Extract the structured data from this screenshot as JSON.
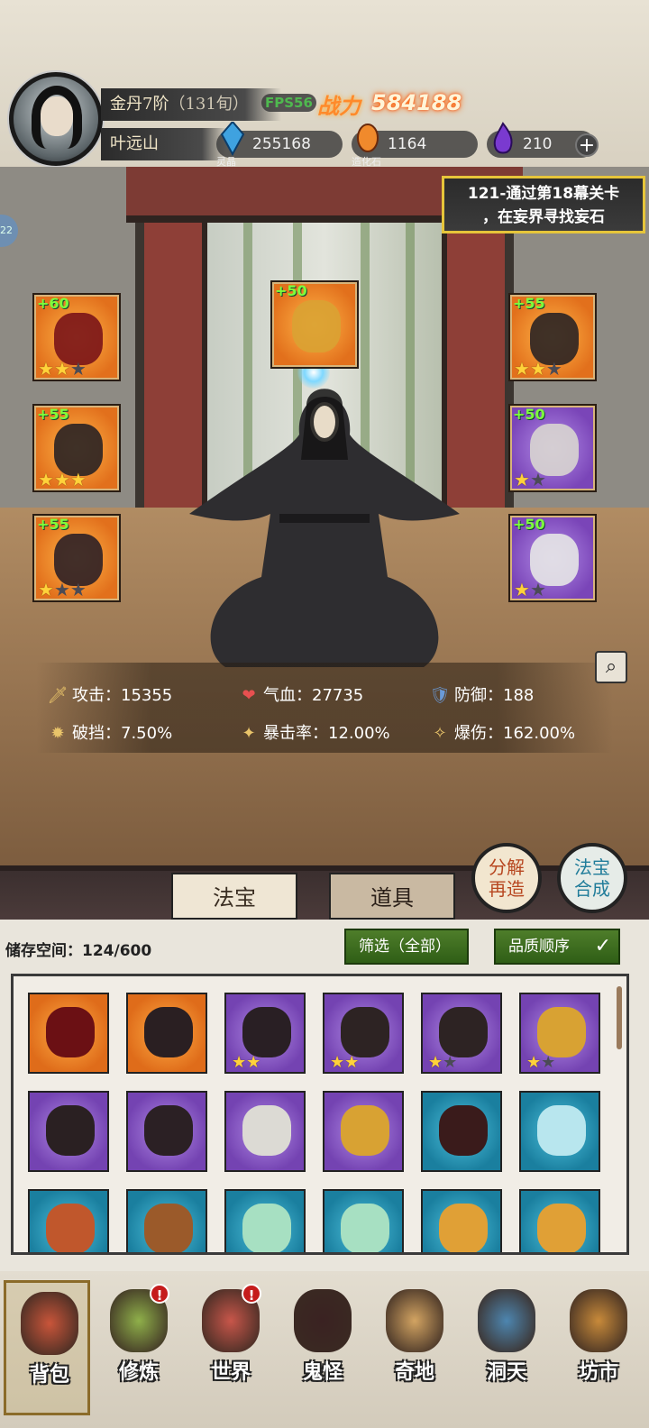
{
  "player": {
    "rank": "金丹7阶",
    "rank_detail": "（131旬）",
    "name": "叶远山",
    "fps": "FPS56",
    "power_label": "战力",
    "power": "584188"
  },
  "resources": [
    {
      "label": "灵晶",
      "value": "255168",
      "icon": "blue-crystal-icon",
      "color": "#3fa2e0"
    },
    {
      "label": "造化石",
      "value": "1164",
      "icon": "orange-stone-icon",
      "color": "#f08a2c"
    },
    {
      "label": "",
      "value": "210",
      "icon": "purple-flame-icon",
      "color": "#7a3ad0"
    }
  ],
  "quest": {
    "line1": "121-通过第18幕关卡",
    "line2": "，在妄界寻找妄石"
  },
  "side_tab": "22",
  "equipment": [
    {
      "level": "+60",
      "stars": 2,
      "max": 3,
      "color": "orange",
      "art": "#7a1418"
    },
    {
      "level": "+50",
      "stars": 0,
      "max": 0,
      "color": "orange",
      "art": "#d9a233"
    },
    {
      "level": "+55",
      "stars": 2,
      "max": 3,
      "color": "orange",
      "art": "#2b2323"
    },
    {
      "level": "+55",
      "stars": 3,
      "max": 3,
      "color": "orange",
      "art": "#2a2224"
    },
    {
      "level": "+50",
      "stars": 1,
      "max": 2,
      "color": "purple",
      "art": "#d8d5d0"
    },
    {
      "level": "+55",
      "stars": 1,
      "max": 3,
      "color": "orange",
      "art": "#2d2026"
    },
    {
      "level": "+50",
      "stars": 1,
      "max": 2,
      "color": "purple",
      "art": "#e6e6e6"
    }
  ],
  "stats": [
    {
      "icon": "sword-icon",
      "glyph": "🗡",
      "text": "攻击：15355"
    },
    {
      "icon": "heart-icon",
      "glyph": "❤",
      "text": "气血：27735"
    },
    {
      "icon": "shield-icon",
      "glyph": "🛡",
      "text": "防御：188"
    },
    {
      "icon": "break-icon",
      "glyph": "✹",
      "text": "破挡：7.50%"
    },
    {
      "icon": "crit-rate-icon",
      "glyph": "✦",
      "text": "暴击率：12.00%"
    },
    {
      "icon": "crit-damage-icon",
      "glyph": "✧",
      "text": "爆伤：162.00%"
    }
  ],
  "tabs": [
    "法宝",
    "道具"
  ],
  "round_buttons": {
    "decompose": [
      "分解",
      "再造"
    ],
    "synthesize": [
      "法宝",
      "合成"
    ]
  },
  "inventory": {
    "storage_label": "储存空间：124/600",
    "filter": "筛选（全部）",
    "sort": "品质顺序",
    "items": [
      {
        "color": "orange",
        "stars": 0,
        "max": 0,
        "art": "#6b1014"
      },
      {
        "color": "orange",
        "stars": 0,
        "max": 0,
        "art": "#2a1f22"
      },
      {
        "color": "purple",
        "stars": 2,
        "max": 2,
        "art": "#291f24"
      },
      {
        "color": "purple",
        "stars": 2,
        "max": 2,
        "art": "#2d2323"
      },
      {
        "color": "purple",
        "stars": 1,
        "max": 2,
        "art": "#2d2323"
      },
      {
        "color": "purple",
        "stars": 1,
        "max": 2,
        "art": "#d8a233"
      },
      {
        "color": "purple",
        "stars": 0,
        "max": 0,
        "art": "#2a2022"
      },
      {
        "color": "purple",
        "stars": 0,
        "max": 0,
        "art": "#2b2024"
      },
      {
        "color": "purple",
        "stars": 0,
        "max": 0,
        "art": "#dcdad4"
      },
      {
        "color": "purple",
        "stars": 0,
        "max": 0,
        "art": "#d8a233"
      },
      {
        "color": "blue",
        "stars": 0,
        "max": 0,
        "art": "#3a1b1b"
      },
      {
        "color": "blue",
        "stars": 0,
        "max": 0,
        "art": "#b8e6ee"
      },
      {
        "color": "blue",
        "stars": 0,
        "max": 0,
        "art": "#c0572c"
      },
      {
        "color": "blue",
        "stars": 0,
        "max": 0,
        "art": "#9b5a2a"
      },
      {
        "color": "blue",
        "stars": 0,
        "max": 0,
        "art": "#a7e0c2"
      },
      {
        "color": "blue",
        "stars": 0,
        "max": 0,
        "art": "#a7e0c2"
      },
      {
        "color": "blue",
        "stars": 0,
        "max": 0,
        "art": "#e0a036"
      },
      {
        "color": "blue",
        "stars": 0,
        "max": 0,
        "art": "#e0a036"
      }
    ]
  },
  "nav": [
    {
      "label": "背包",
      "icon": "bag-icon",
      "badge": "",
      "active": true,
      "color": "#c9553a"
    },
    {
      "label": "修炼",
      "icon": "lotus-icon",
      "badge": "!",
      "active": false,
      "color": "#8fb04a"
    },
    {
      "label": "世界",
      "icon": "scroll-icon",
      "badge": "!",
      "active": false,
      "color": "#c8564a"
    },
    {
      "label": "鬼怪",
      "icon": "demon-egg-icon",
      "badge": "",
      "active": false,
      "color": "#3a2222"
    },
    {
      "label": "奇地",
      "icon": "mountain-icon",
      "badge": "",
      "active": false,
      "color": "#d3a462"
    },
    {
      "label": "洞天",
      "icon": "portal-icon",
      "badge": "",
      "active": false,
      "color": "#4d86b0"
    },
    {
      "label": "坊市",
      "icon": "market-stall-icon",
      "badge": "",
      "active": false,
      "color": "#c88a3a"
    }
  ]
}
